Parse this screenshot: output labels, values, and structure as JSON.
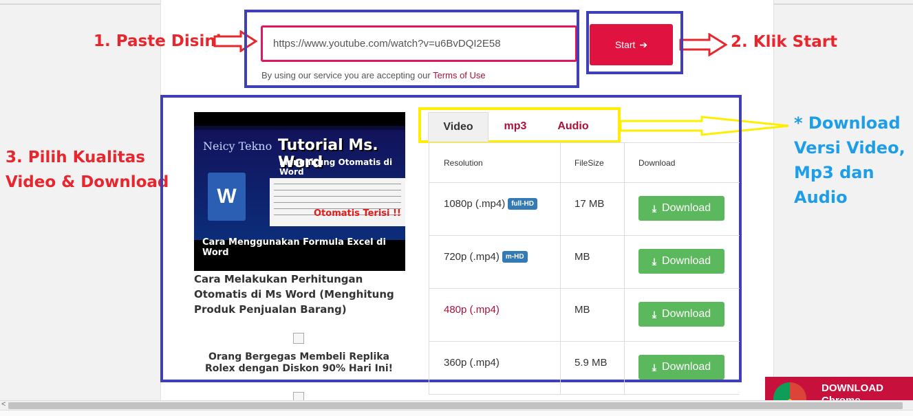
{
  "form": {
    "url_value": "https://www.youtube.com/watch?v=u6BvDQI2E58",
    "start_label": "Start",
    "terms_prefix": "By using our service you are accepting our ",
    "terms_link": "Terms of Use"
  },
  "annotations": {
    "step1": "1. Paste Disini",
    "step2": "2. Klik Start",
    "step3_line1": "3. Pilih Kualitas",
    "step3_line2": "Video & Download",
    "note_line1": "* Download",
    "note_line2": "Versi Video,",
    "note_line3": "Mp3 dan",
    "note_line4": "Audio",
    "colors": {
      "red": "#e8262e",
      "blue": "#1e9ee8",
      "box_blue": "#3f3fb8",
      "box_yellow": "#ffee00"
    }
  },
  "thumbnail": {
    "brand": "Neicy Tekno",
    "title": "Tutorial Ms. Word",
    "subtitle": "Menghitung Otomatis di Word",
    "logo_letter": "W",
    "badge": "Otomatis Terisi !!",
    "caption": "Cara Menggunakan Formula Excel di Word"
  },
  "video": {
    "title": "Cara Melakukan Perhitungan Otomatis di Ms Word (Menghitung Produk Penjualan Barang)"
  },
  "ad": {
    "text": "Orang Bergegas Membeli Replika Rolex dengan Diskon 90% Hari Ini!"
  },
  "tabs": [
    {
      "label": "Video",
      "active": true
    },
    {
      "label": "mp3",
      "active": false
    },
    {
      "label": "Audio",
      "active": false
    }
  ],
  "table": {
    "headers": [
      "Resolution",
      "FileSize",
      "Download"
    ],
    "rows": [
      {
        "resolution": "1080p (.mp4)",
        "badge": "full-HD",
        "size": "17 MB",
        "button": "Download"
      },
      {
        "resolution": "720p (.mp4)",
        "badge": "m-HD",
        "size": "MB",
        "button": "Download"
      },
      {
        "resolution": "480p (.mp4)",
        "badge": "",
        "size": "MB",
        "button": "Download"
      },
      {
        "resolution": "360p (.mp4)",
        "badge": "",
        "size": "5.9 MB",
        "button": "Download"
      }
    ]
  },
  "chrome_ad": {
    "line1": "DOWNLOAD",
    "line2": "Chrome"
  },
  "icons": {
    "start_arrow": "arrow-right-icon",
    "download": "download-icon"
  }
}
